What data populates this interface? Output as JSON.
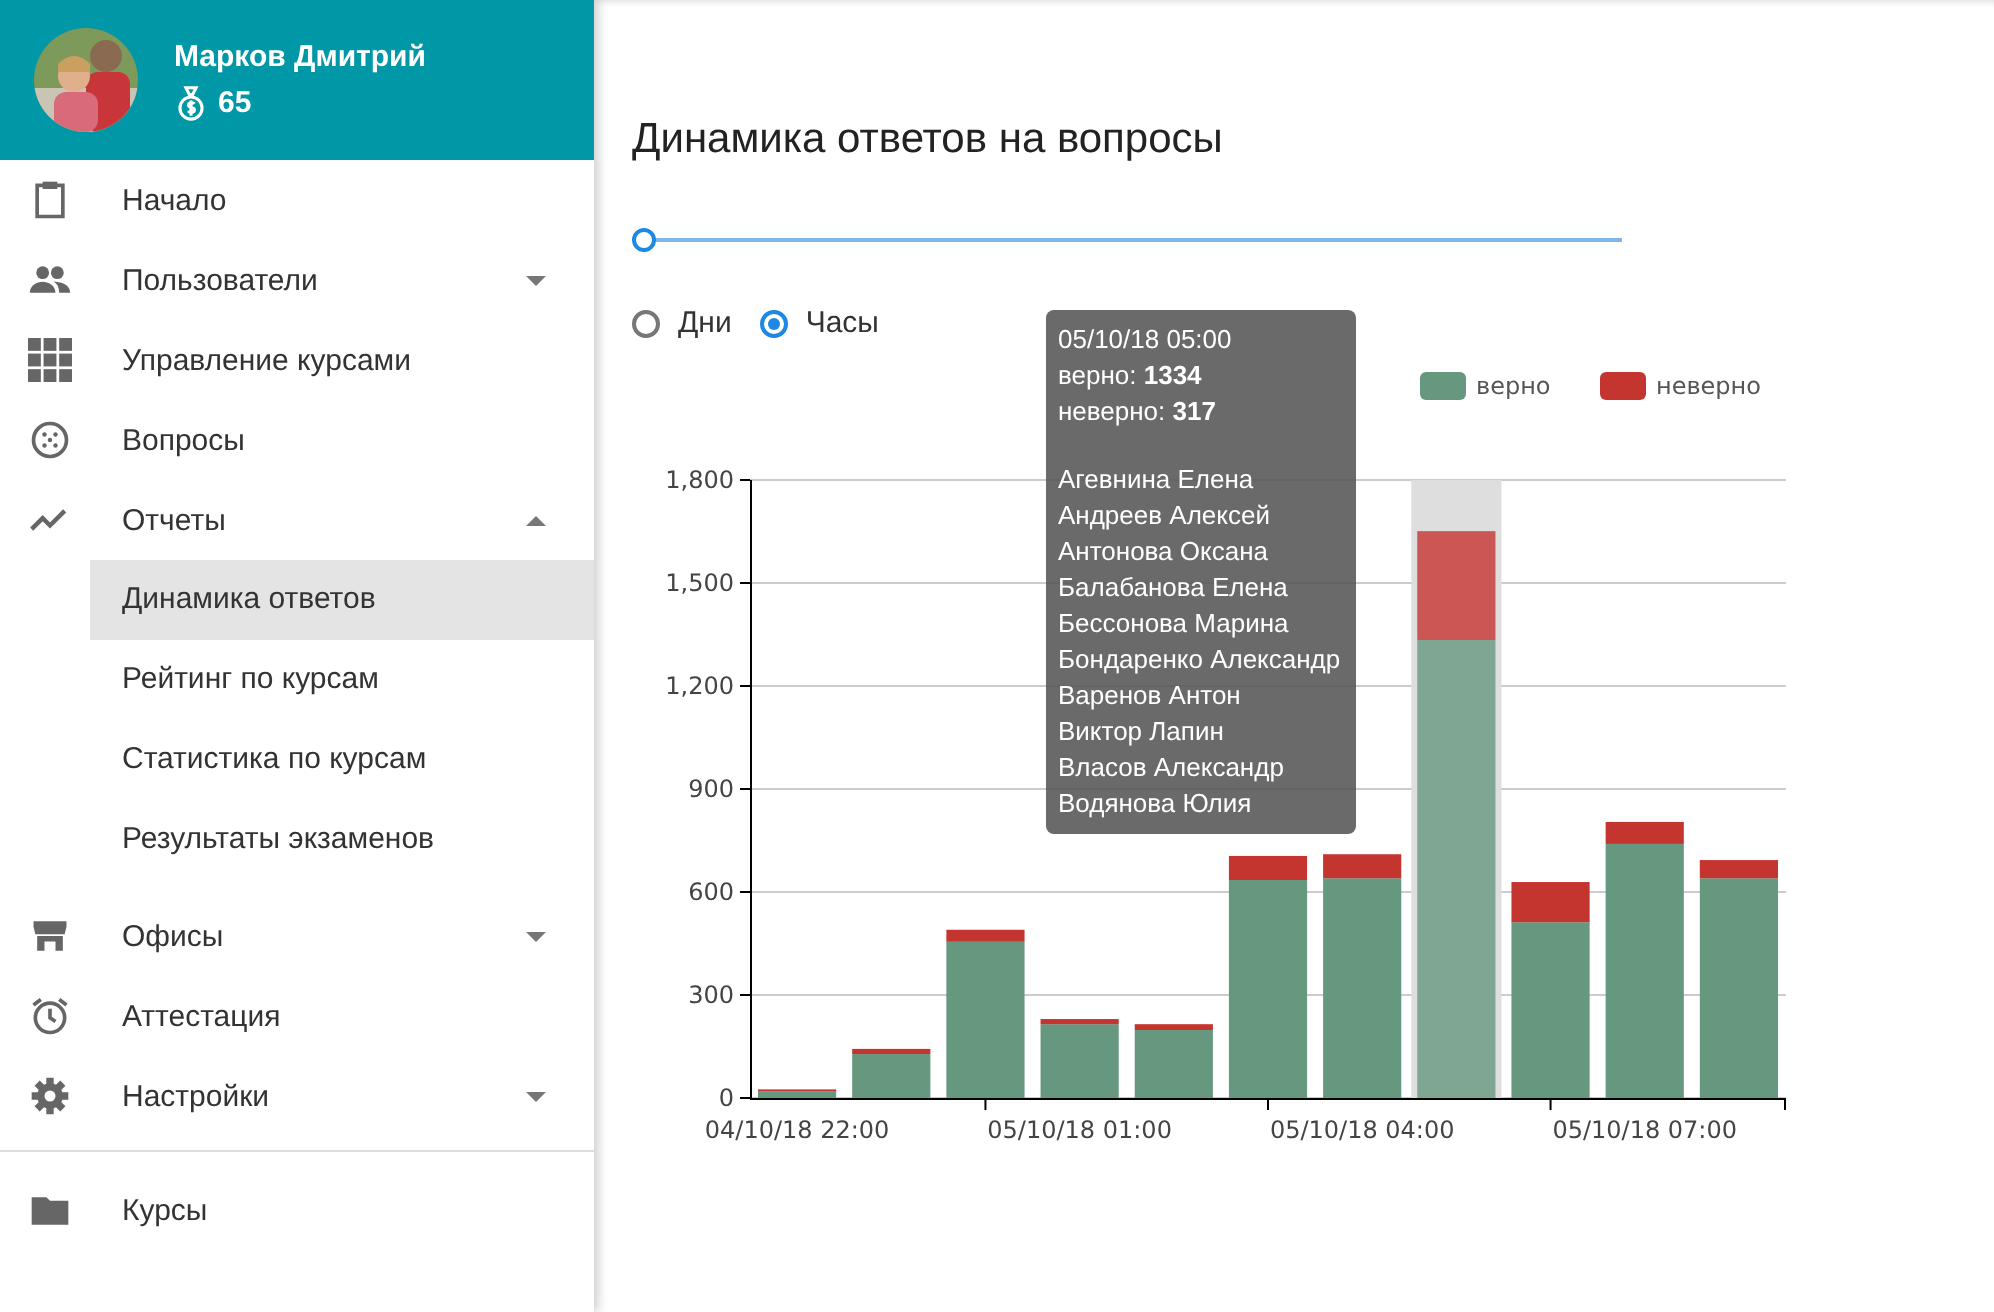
{
  "user": {
    "name": "Марков Дмитрий",
    "coins": "65"
  },
  "sidebar": {
    "items": [
      {
        "label": "Начало"
      },
      {
        "label": "Пользователи",
        "expanded": false
      },
      {
        "label": "Управление курсами"
      },
      {
        "label": "Вопросы"
      },
      {
        "label": "Отчеты",
        "expanded": true,
        "children": [
          {
            "label": "Динамика ответов",
            "selected": true
          },
          {
            "label": "Рейтинг по курсам",
            "selected": false
          },
          {
            "label": "Статистика по курсам",
            "selected": false
          },
          {
            "label": "Результаты экзаменов",
            "selected": false
          }
        ]
      },
      {
        "label": "Офисы",
        "expanded": false
      },
      {
        "label": "Аттестация"
      },
      {
        "label": "Настройки",
        "expanded": false
      }
    ],
    "footer_items": [
      {
        "label": "Курсы"
      }
    ]
  },
  "main": {
    "title": "Динамика ответов на вопросы",
    "range_slider": {
      "level": 0
    },
    "period": [
      {
        "label": "Дни",
        "selected": false
      },
      {
        "label": "Часы",
        "selected": true
      }
    ],
    "bars": [
      {
        "selected": false
      },
      {
        "selected": false
      },
      {
        "selected": false
      },
      {
        "selected": false
      },
      {
        "selected": false
      },
      {
        "selected": false
      },
      {
        "selected": false
      },
      {
        "selected": true
      },
      {
        "selected": false
      },
      {
        "selected": false
      },
      {
        "selected": false
      }
    ],
    "tooltip": {
      "date": "05/10/18 05:00",
      "lines": [
        "верно: **1334**",
        "неверно: **317**"
      ],
      "names": [
        "Агевнина Елена",
        "Андреев Алексей",
        "Антонова Оксана",
        "Балабанова Елена",
        "Бессонова Марина",
        "Бондаренко Александр",
        "Варенов Антон",
        "Виктор Лапин",
        "Власов Александр",
        "Водянова Юлия"
      ]
    },
    "chart_data": {
      "type": "bar",
      "stacked": true,
      "grid": true,
      "legend": "top",
      "categories": [
        "04/10/18 22:00",
        null,
        null,
        "05/10/18 01:00",
        null,
        null,
        "05/10/18 04:00",
        null,
        null,
        "05/10/18 07:00",
        null
      ],
      "series": [
        {
          "name": "верно",
          "color": "#66977f",
          "values": [
            20,
            128,
            455,
            215,
            198,
            635,
            640,
            1334,
            512,
            740,
            640
          ]
        },
        {
          "name": "неверно",
          "color": "#c43530",
          "values": [
            5,
            15,
            35,
            15,
            17,
            70,
            70,
            317,
            117,
            64,
            53
          ]
        }
      ],
      "ylim": [
        0,
        1800
      ],
      "yticks": [
        {
          "value": 0,
          "label": "0"
        },
        {
          "value": 300,
          "label": "300"
        },
        {
          "value": 600,
          "label": "600"
        },
        {
          "value": 900,
          "label": "900"
        },
        {
          "value": 1200,
          "label": "1,200"
        },
        {
          "value": 1500,
          "label": "1,500"
        },
        {
          "value": 1800,
          "label": "1,800"
        }
      ]
    }
  }
}
